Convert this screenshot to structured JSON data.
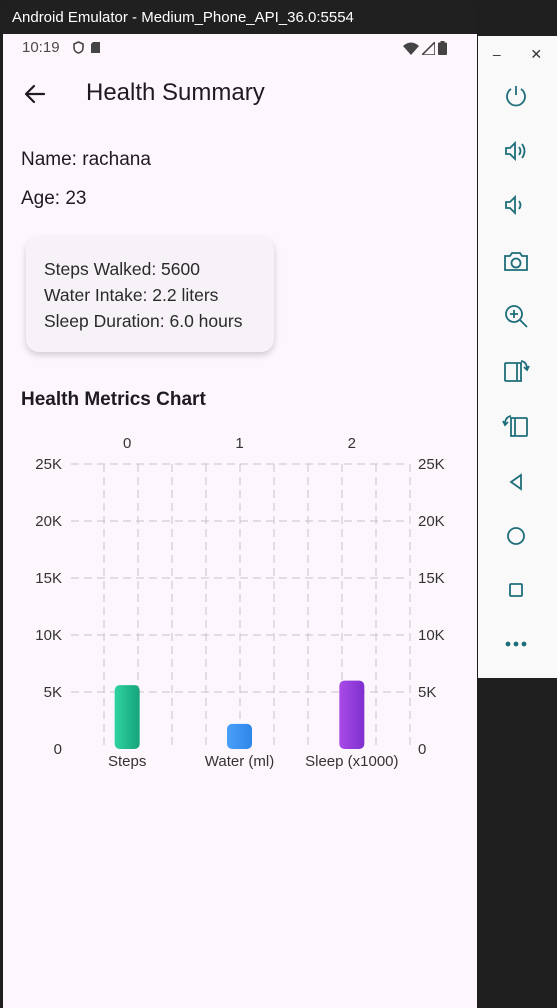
{
  "window": {
    "title": "Android Emulator - Medium_Phone_API_36.0:5554"
  },
  "status_bar": {
    "time": "10:19"
  },
  "app_bar": {
    "title": "Health Summary"
  },
  "profile": {
    "name_line": "Name: rachana",
    "age_line": "Age: 23"
  },
  "summary_card": {
    "steps_line": "Steps Walked: 5600",
    "water_line": "Water Intake: 2.2 liters",
    "sleep_line": "Sleep Duration: 6.0 hours"
  },
  "chart_section": {
    "title": "Health Metrics Chart"
  },
  "chart_data": {
    "type": "bar",
    "categories": [
      "Steps",
      "Water (ml)",
      "Sleep (x1000)"
    ],
    "top_axis_labels": [
      "0",
      "1",
      "2"
    ],
    "values": [
      5600,
      2200,
      6000
    ],
    "ylim": [
      0,
      25000
    ],
    "y_ticks": [
      0,
      5000,
      10000,
      15000,
      20000,
      25000
    ],
    "y_tick_labels": [
      "0",
      "5K",
      "10K",
      "15K",
      "20K",
      "25K"
    ],
    "grid": true,
    "bar_gradients": [
      [
        "#2ed3a0",
        "#16a37b"
      ],
      [
        "#4a9ff8",
        "#2f86e8"
      ],
      [
        "#a94be6",
        "#7e2fd0"
      ]
    ]
  },
  "emulator_controls": {
    "minimize": "–",
    "close": "✕",
    "buttons": [
      "power-icon",
      "volume-up-icon",
      "volume-down-icon",
      "camera-icon",
      "zoom-in-icon",
      "rotate-left-icon",
      "rotate-right-icon",
      "back-icon",
      "home-icon",
      "overview-icon",
      "more-icon"
    ]
  }
}
